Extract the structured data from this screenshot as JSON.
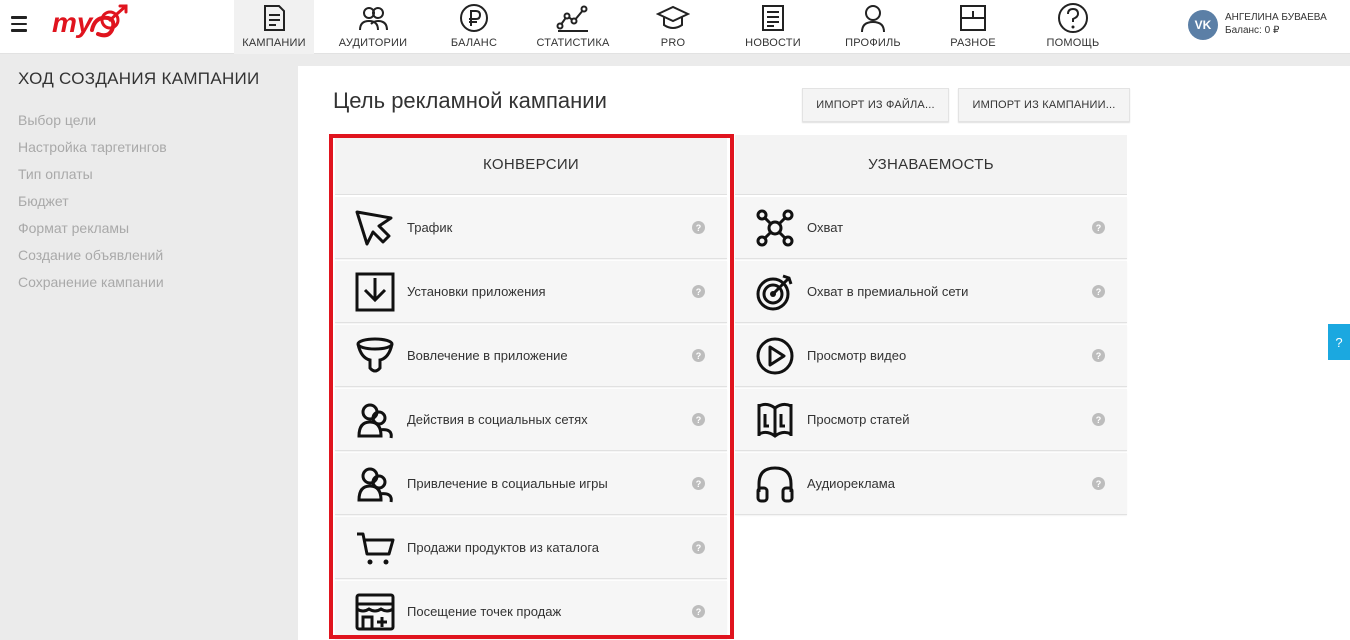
{
  "brand": {
    "logo_text": "my",
    "accent": "#e0141e"
  },
  "nav": [
    {
      "label": "КАМПАНИИ",
      "icon": "document-icon",
      "active": true
    },
    {
      "label": "АУДИТОРИИ",
      "icon": "audience-icon",
      "active": false
    },
    {
      "label": "БАЛАНС",
      "icon": "ruble-icon",
      "active": false
    },
    {
      "label": "СТАТИСТИКА",
      "icon": "stats-line-icon",
      "active": false
    },
    {
      "label": "PRO",
      "icon": "graduation-cap-icon",
      "active": false
    },
    {
      "label": "НОВОСТИ",
      "icon": "newspaper-icon",
      "active": false
    },
    {
      "label": "ПРОФИЛЬ",
      "icon": "user-icon",
      "active": false
    },
    {
      "label": "РАЗНОЕ",
      "icon": "box-plus-icon",
      "active": false
    },
    {
      "label": "ПОМОЩЬ",
      "icon": "question-icon",
      "active": false
    }
  ],
  "user": {
    "badge": "VK",
    "name": "АНГЕЛИНА БУВАЕВА",
    "balance": "Баланс: 0 ₽"
  },
  "sidebar": {
    "title": "ХОД СОЗДАНИЯ КАМПАНИИ",
    "steps": [
      "Выбор цели",
      "Настройка таргетингов",
      "Тип оплаты",
      "Бюджет",
      "Формат рекламы",
      "Создание объявлений",
      "Сохранение кампании"
    ]
  },
  "main": {
    "title": "Цель рекламной кампании",
    "import_file": "ИМПОРТ ИЗ ФАЙЛА...",
    "import_campaign": "ИМПОРТ ИЗ КАМПАНИИ..."
  },
  "conversions": {
    "header": "КОНВЕРСИИ",
    "items": [
      {
        "label": "Трафик",
        "icon": "cursor-icon"
      },
      {
        "label": "Установки приложения",
        "icon": "download-box-icon"
      },
      {
        "label": "Вовлечение в приложение",
        "icon": "funnel-icon"
      },
      {
        "label": "Действия в социальных сетях",
        "icon": "social-users-icon"
      },
      {
        "label": "Привлечение в социальные игры",
        "icon": "social-games-icon"
      },
      {
        "label": "Продажи продуктов из каталога",
        "icon": "cart-icon"
      },
      {
        "label": "Посещение точек продаж",
        "icon": "store-icon"
      }
    ]
  },
  "awareness": {
    "header": "УЗНАВАЕМОСТЬ",
    "items": [
      {
        "label": "Охват",
        "icon": "reach-network-icon"
      },
      {
        "label": "Охват в премиальной сети",
        "icon": "target-arrow-icon"
      },
      {
        "label": "Просмотр видео",
        "icon": "play-circle-icon"
      },
      {
        "label": "Просмотр статей",
        "icon": "book-icon"
      },
      {
        "label": "Аудиореклама",
        "icon": "headphones-icon"
      }
    ]
  },
  "help_glyph": "?",
  "side_help": "?"
}
